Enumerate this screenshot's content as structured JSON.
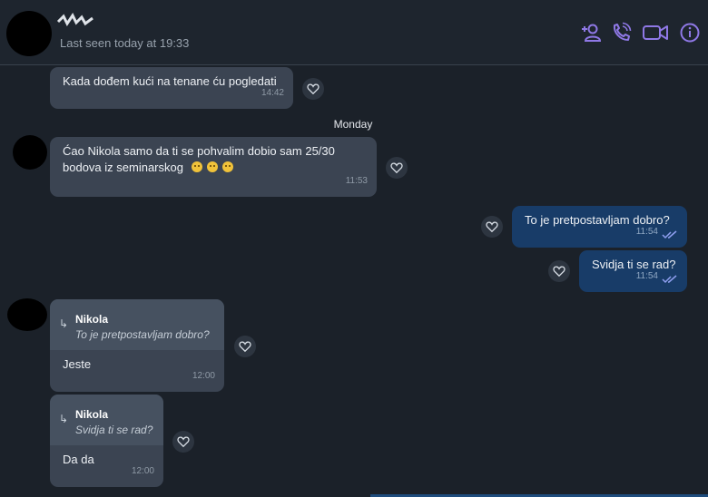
{
  "header": {
    "status": "Last seen today at 19:33",
    "icons": [
      "add-participant-icon",
      "phone-icon",
      "video-call-icon",
      "info-icon"
    ],
    "accent_color": "#8f78e6"
  },
  "messages": {
    "m1": {
      "text": "Kada dođem kući na tenane ću pogledati",
      "time": "14:42"
    },
    "day_separator": "Monday",
    "m2": {
      "text_line1": "Ćao Nikola samo da ti se pohvalim dobio sam 25/30",
      "text_line2": "bodova iz seminarskog",
      "time": "11:53"
    },
    "m3": {
      "text": "To je pretpostavljam dobro?",
      "time": "11:54"
    },
    "m4": {
      "text": "Svidja ti se rad?",
      "time": "11:54"
    },
    "m5": {
      "quote_name": "Nikola",
      "quote_text": "To je pretpostavljam dobro?",
      "text": "Jeste",
      "time": "12:00"
    },
    "m6": {
      "quote_name": "Nikola",
      "quote_text": "Svidja ti se rad?",
      "text": "Da da",
      "time": "12:00"
    }
  },
  "colors": {
    "incoming_bubble": "#3b4452",
    "outgoing_bubble": "#183c68",
    "background": "#1b2129"
  }
}
